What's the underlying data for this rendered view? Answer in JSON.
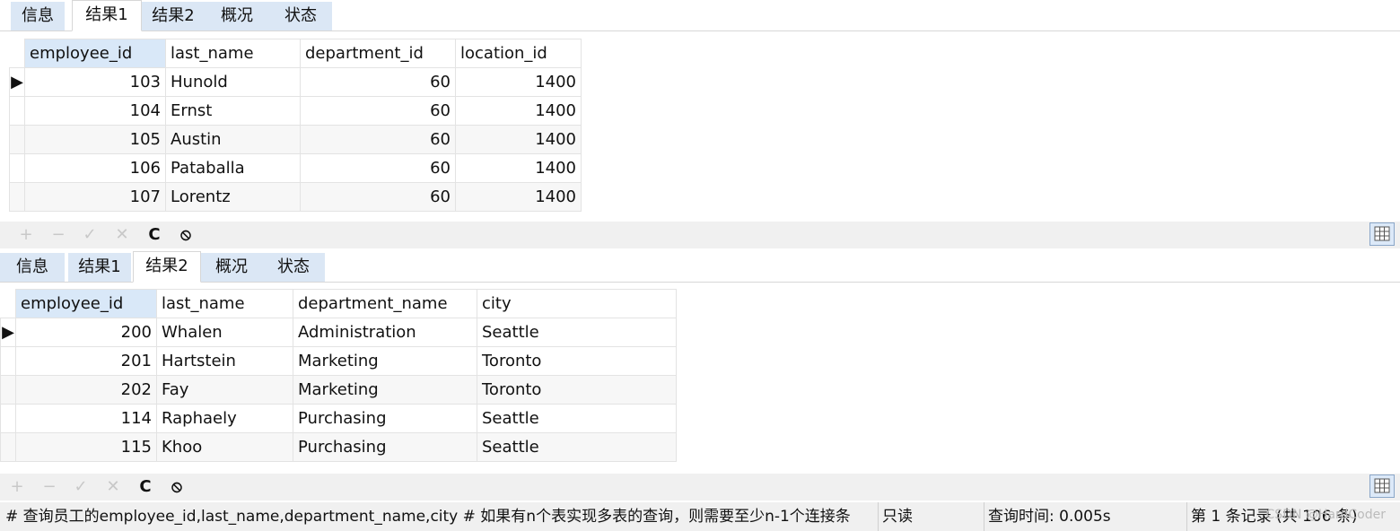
{
  "tabs1": [
    "信息",
    "结果1",
    "结果2",
    "概况",
    "状态"
  ],
  "tabs2": [
    "信息",
    "结果1",
    "结果2",
    "概况",
    "状态"
  ],
  "result1": {
    "headers": [
      "employee_id",
      "last_name",
      "department_id",
      "location_id"
    ],
    "rows": [
      [
        "103",
        "Hunold",
        "60",
        "1400"
      ],
      [
        "104",
        "Ernst",
        "60",
        "1400"
      ],
      [
        "105",
        "Austin",
        "60",
        "1400"
      ],
      [
        "106",
        "Pataballa",
        "60",
        "1400"
      ],
      [
        "107",
        "Lorentz",
        "60",
        "1400"
      ]
    ]
  },
  "result2": {
    "headers": [
      "employee_id",
      "last_name",
      "department_name",
      "city"
    ],
    "rows": [
      [
        "200",
        "Whalen",
        "Administration",
        "Seattle"
      ],
      [
        "201",
        "Hartstein",
        "Marketing",
        "Toronto"
      ],
      [
        "202",
        "Fay",
        "Marketing",
        "Toronto"
      ],
      [
        "114",
        "Raphaely",
        "Purchasing",
        "Seattle"
      ],
      [
        "115",
        "Khoo",
        "Purchasing",
        "Seattle"
      ]
    ]
  },
  "toolbar": {
    "add": "+",
    "remove": "−",
    "apply": "✓",
    "cancel": "✕",
    "refresh": "C",
    "stop": "⦸"
  },
  "status": {
    "query": "# 查询员工的employee_id,last_name,department_name,city # 如果有n个表实现多表的查询，则需要至少n-1个连接条",
    "mode": "只读",
    "time": "查询时间: 0.005s",
    "records": "第 1 条记录 (共 106 条)",
    "watermark": "CSDN @HardCoder"
  }
}
